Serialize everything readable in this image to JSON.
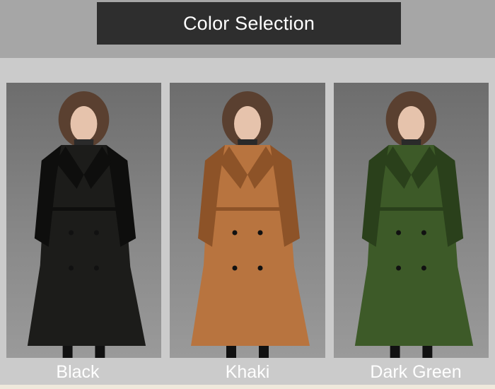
{
  "header": {
    "title": "Color Selection"
  },
  "options": [
    {
      "label": "Black",
      "coat_color": "#1c1c1a",
      "coat_shade": "#0e0e0d"
    },
    {
      "label": "Khaki",
      "coat_color": "#b8743f",
      "coat_shade": "#8d5328"
    },
    {
      "label": "Dark Green",
      "coat_color": "#3d5a28",
      "coat_shade": "#2a401b"
    }
  ]
}
